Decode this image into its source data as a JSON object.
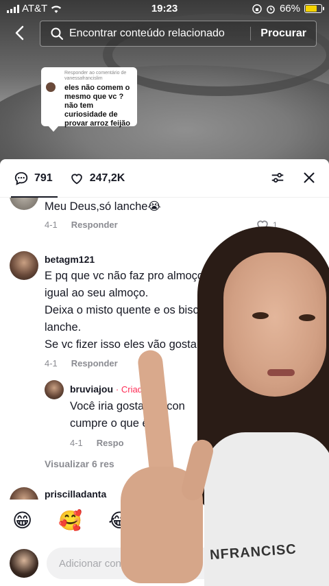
{
  "status_bar": {
    "carrier": "AT&T",
    "time": "19:23",
    "battery": "66%",
    "battery_level": 0.66
  },
  "search": {
    "placeholder": "Encontrar conteúdo relacionado",
    "button": "Procurar"
  },
  "reply_sticker": {
    "header": "Responder ao comentário de vanessafrancislim",
    "text": "eles não comem o mesmo que vc ? não tem curiosidade de provar arroz feijão"
  },
  "panel": {
    "comment_count": "791",
    "like_count": "247,2K"
  },
  "comments": [
    {
      "text": "Meu Deus,só lanche😭",
      "date": "4-1",
      "reply_label": "Responder",
      "likes": "1"
    },
    {
      "username": "betagm121",
      "lines": [
        "E pq que vc não faz pro almoço da",
        "igual ao seu almoço.",
        "Deixa o misto quente e os bisc",
        "lanche.",
        "Se vc fizer isso eles vão gosta"
      ],
      "date": "4-1",
      "reply_label": "Responder"
    },
    {
      "username": "bruviajou",
      "badge": "· Criado",
      "lines": [
        "Você iria gostar de con",
        "cumpre o que    ê ma"
      ],
      "date": "4-1",
      "reply_label": "Respo"
    }
  ],
  "view_more": "Visualizar 6 res",
  "next_username": "priscilladanta",
  "emojis": [
    "😁",
    "🥰",
    "😂"
  ],
  "input": {
    "placeholder": "Adicionar con"
  },
  "overlay_shirt_text": "NFRANCISC"
}
